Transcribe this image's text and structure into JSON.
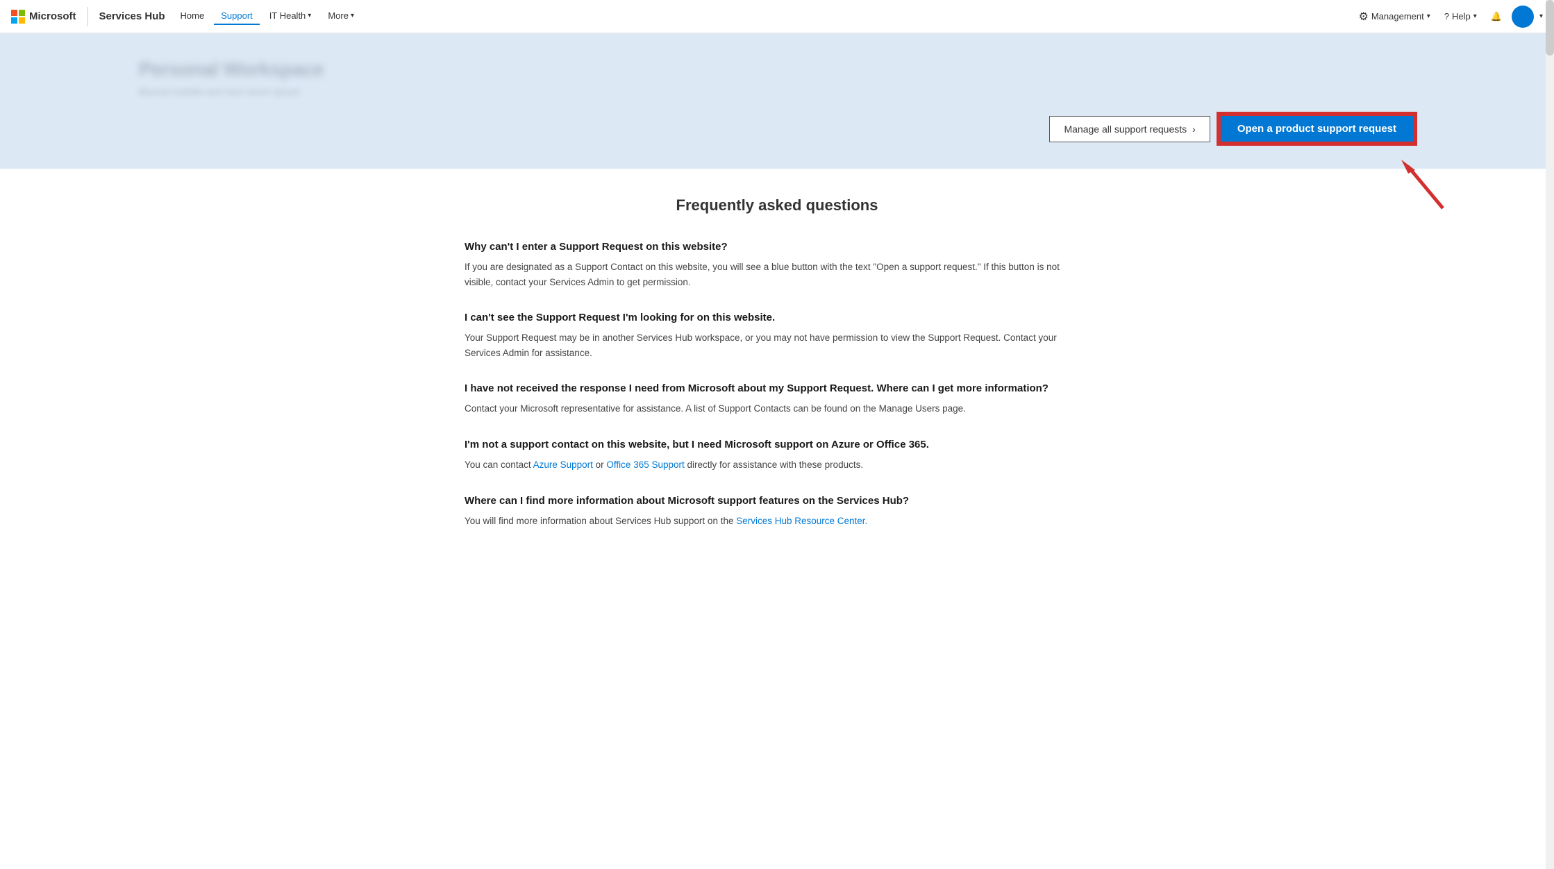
{
  "navbar": {
    "brand": "Microsoft",
    "app_name": "Services Hub",
    "nav_links": [
      {
        "label": "Home",
        "active": false
      },
      {
        "label": "Support",
        "active": true
      },
      {
        "label": "IT Health",
        "has_arrow": true,
        "active": false
      },
      {
        "label": "More",
        "has_arrow": true,
        "active": false
      }
    ],
    "management_label": "Management",
    "help_label": "Help",
    "notification_icon": "🔔"
  },
  "hero": {
    "title": "Personal Workspace",
    "subtitle": "Blurred subtitle text here lorem ipsum",
    "manage_button_label": "Manage all support requests",
    "open_request_button_label": "Open a product support request"
  },
  "faq": {
    "title": "Frequently asked questions",
    "items": [
      {
        "question": "Why can't I enter a Support Request on this website?",
        "answer": "If you are designated as a Support Contact on this website, you will see a blue button with the text \"Open a support request.\" If this button is not visible, contact your Services Admin to get permission."
      },
      {
        "question": "I can't see the Support Request I'm looking for on this website.",
        "answer": "Your Support Request may be in another Services Hub workspace, or you may not have permission to view the Support Request. Contact your Services Admin for assistance."
      },
      {
        "question": "I have not received the response I need from Microsoft about my Support Request. Where can I get more information?",
        "answer": "Contact your Microsoft representative for assistance. A list of Support Contacts can be found on the Manage Users page."
      },
      {
        "question": "I'm not a support contact on this website, but I need Microsoft support on Azure or Office 365.",
        "answer_prefix": "You can contact ",
        "link1_label": "Azure Support",
        "link1_href": "#",
        "answer_middle": " or ",
        "link2_label": "Office 365 Support",
        "link2_href": "#",
        "answer_suffix": " directly for assistance with these products."
      },
      {
        "question": "Where can I find more information about Microsoft support features on the Services Hub?",
        "answer_prefix": "You will find more information about Services Hub support on the ",
        "link1_label": "Services Hub Resource Center.",
        "link1_href": "#",
        "answer_suffix": ""
      }
    ]
  }
}
